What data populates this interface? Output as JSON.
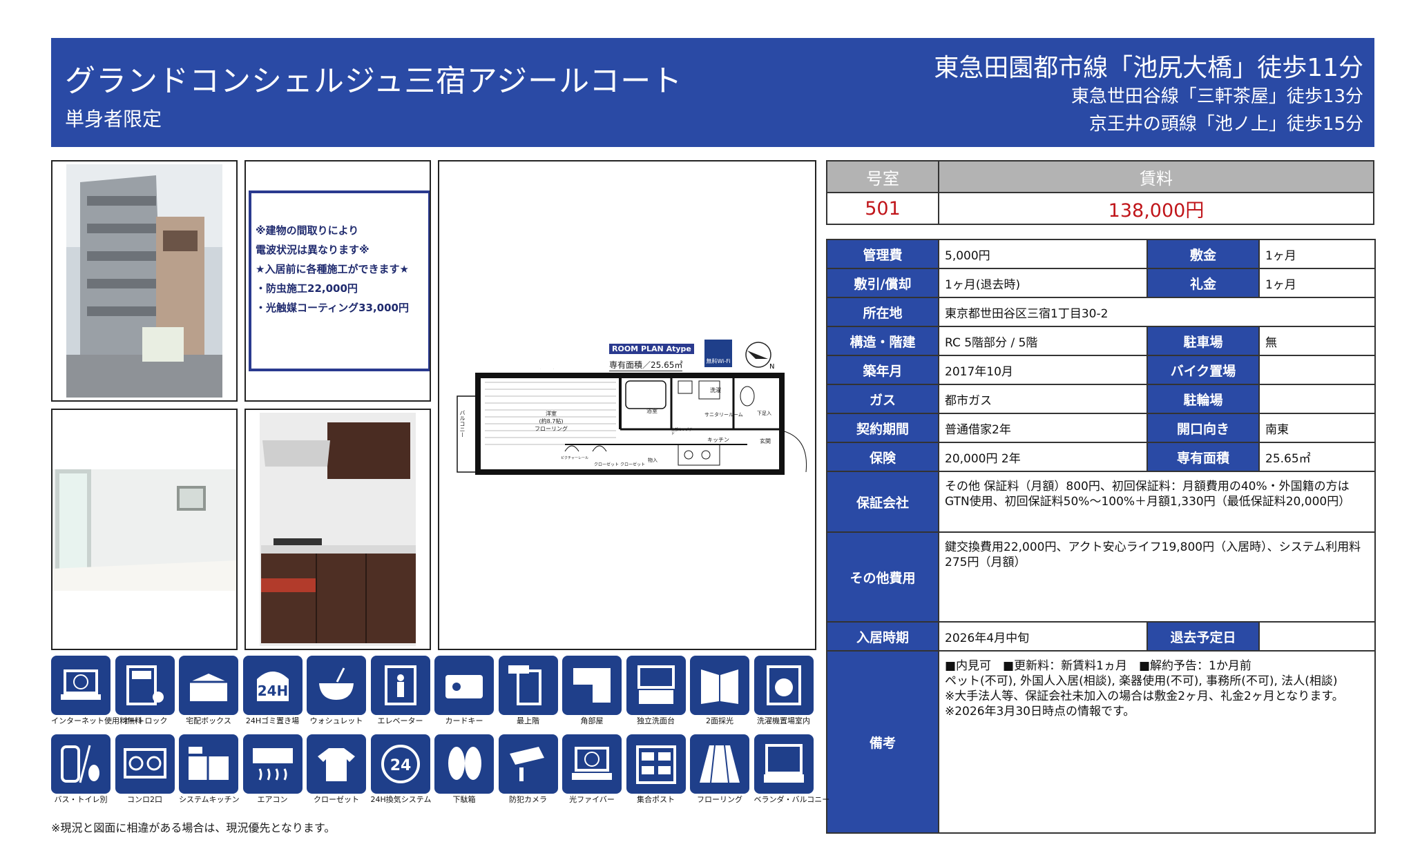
{
  "header": {
    "building_name": "グランドコンシェルジュ三宿アジールコート",
    "subtitle": "単身者限定",
    "stations": [
      "東急田園都市線「池尻大橋」徒歩11分",
      "東急世田谷線「三軒茶屋」徒歩13分",
      "京王井の頭線「池ノ上」徒歩15分"
    ]
  },
  "notice": {
    "lines": [
      "※建物の間取りにより",
      "電波状況は異なります※",
      "",
      "★入居前に各種施工ができます★",
      "・防虫施工22,000円",
      "・光触媒コーティング33,000円"
    ]
  },
  "floorplan": {
    "plan_label": "ROOM PLAN  Atype",
    "area_label": "専有面積／25.65㎡",
    "wifi_label": "無料Wi-Fi",
    "rooms": {
      "western": "洋室",
      "western_size": "(約8.7帖)",
      "flooring": "フローリング",
      "bath": "浴室",
      "washer": "洗濯",
      "sanitary": "サニタリールーム",
      "kitchen": "キッチン",
      "entrance": "玄関",
      "shoebox": "下足入",
      "storage": "物入",
      "closet1": "クローゼット",
      "closet2": "クローゼット",
      "balcony": "バルコニー",
      "cabinet": "上部カップボード",
      "bench": "ピクチャーレール"
    }
  },
  "room": {
    "label": "号室",
    "value": "501"
  },
  "rent": {
    "label": "賃料",
    "value": "138,000円"
  },
  "spec": {
    "kanri_label": "管理費",
    "kanri": "5,000円",
    "shikikin_label": "敷金",
    "shikikin": "1ヶ月",
    "shikibiki_label": "敷引/償却",
    "shikibiki": "1ヶ月(退去時)",
    "reikin_label": "礼金",
    "reikin": "1ヶ月",
    "address_label": "所在地",
    "address": "東京都世田谷区三宿1丁目30-2",
    "structure_label": "構造・階建",
    "structure": "RC 5階部分 / 5階",
    "parking_label": "駐車場",
    "parking": "無",
    "built_label": "築年月",
    "built": "2017年10月",
    "bike_label": "バイク置場",
    "bike": "",
    "gas_label": "ガス",
    "gas": "都市ガス",
    "bicycle_label": "駐輪場",
    "bicycle": "",
    "contract_label": "契約期間",
    "contract": "普通借家2年",
    "facing_label": "開口向き",
    "facing": "南東",
    "insurance_label": "保険",
    "insurance": "20,000円 2年",
    "area_label": "専有面積",
    "area": "25.65㎡",
    "guarantee_label": "保証会社",
    "guarantee": "その他 保証料（月額）800円、初回保証料：月額費用の40%・外国籍の方はGTN使用、初回保証料50%～100%＋月額1,330円（最低保証料20,000円）",
    "other_label": "その他費用",
    "other": "鍵交換費用22,000円、アクト安心ライフ19,800円（入居時）、システム利用料275円（月額）",
    "movein_label": "入居時期",
    "movein": "2026年4月中旬",
    "moveout_label": "退去予定日",
    "moveout": "",
    "remarks_label": "備考",
    "remarks": [
      "■内見可　■更新料：新賃料1ヵ月　■解約予告：1か月前",
      "ペット(不可), 外国人入居(相談), 楽器使用(不可), 事務所(不可), 法人(相談)",
      "※大手法人等、保証会社未加入の場合は敷金2ヶ月、礼金2ヶ月となります。",
      "※2026年3月30日時点の情報です。"
    ]
  },
  "amenities": [
    {
      "icon": "internet-icon",
      "label": "インターネット使用料無料"
    },
    {
      "icon": "autolock-icon",
      "label": "オートロック"
    },
    {
      "icon": "delivery-box-icon",
      "label": "宅配ボックス"
    },
    {
      "icon": "garbage-24h-icon",
      "label": "24Hゴミ置き場"
    },
    {
      "icon": "washlet-icon",
      "label": "ウォシュレット"
    },
    {
      "icon": "elevator-icon",
      "label": "エレベーター"
    },
    {
      "icon": "cardkey-icon",
      "label": "カードキー"
    },
    {
      "icon": "top-floor-icon",
      "label": "最上階"
    },
    {
      "icon": "corner-room-icon",
      "label": "角部屋"
    },
    {
      "icon": "vanity-icon",
      "label": "独立洗面台"
    },
    {
      "icon": "two-side-light-icon",
      "label": "2面採光"
    },
    {
      "icon": "washer-indoor-icon",
      "label": "洗濯機置場室内"
    },
    {
      "icon": "bath-toilet-separate-icon",
      "label": "バス・トイレ別"
    },
    {
      "icon": "two-burner-icon",
      "label": "コンロ2口"
    },
    {
      "icon": "system-kitchen-icon",
      "label": "システムキッチン"
    },
    {
      "icon": "aircon-icon",
      "label": "エアコン"
    },
    {
      "icon": "closet-icon",
      "label": "クローゼット"
    },
    {
      "icon": "ventilation-24h-icon",
      "label": "24H換気システム"
    },
    {
      "icon": "shoebox-icon",
      "label": "下駄箱"
    },
    {
      "icon": "security-camera-icon",
      "label": "防犯カメラ"
    },
    {
      "icon": "fiber-icon",
      "label": "光ファイバー"
    },
    {
      "icon": "mailbox-icon",
      "label": "集合ポスト"
    },
    {
      "icon": "flooring-icon",
      "label": "フローリング"
    },
    {
      "icon": "balcony-icon",
      "label": "ベランダ・バルコニー"
    }
  ],
  "footer_note": "※現況と図面に相違がある場合は、現況優先となります。"
}
